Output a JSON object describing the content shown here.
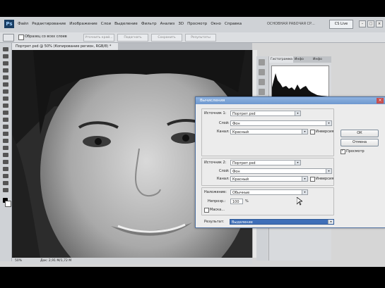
{
  "app": {
    "logo": "Ps",
    "menu": [
      "Файл",
      "Редактирование",
      "Изображение",
      "Слои",
      "Выделение",
      "Фильтр",
      "Анализ",
      "3D",
      "Просмотр",
      "Окно",
      "Справка"
    ],
    "workspace": "ОСНОВНАЯ РАБОЧАЯ СР...",
    "cs_live": "CS Live",
    "options": {
      "sample_all_layers": "Образец со всех слоев",
      "buttons": [
        "Уточнить край...",
        "Подогнать",
        "Сохранить",
        "Результаты"
      ]
    },
    "doc_tab": "Портрет.psd @ 50% (Копирование регион, RGB/8) *",
    "status": {
      "zoom": "50%",
      "doc": "Док: 2,91 М/1,72 М"
    }
  },
  "panel": {
    "tabs": [
      "Гистограмма",
      "Инфо",
      "Инфо"
    ]
  },
  "dialog": {
    "title": "Вычисления",
    "source1": {
      "label": "Источник 1:",
      "value": "Портрет.psd",
      "layer_label": "Слой:",
      "layer_value": "Фон",
      "channel_label": "Канал:",
      "channel_value": "Красный",
      "invert_label": "Инверсия"
    },
    "source2": {
      "label": "Источник 2:",
      "value": "Портрет.psd",
      "layer_label": "Слой:",
      "layer_value": "Фон",
      "channel_label": "Канал:",
      "channel_value": "Красный",
      "invert_label": "Инверсия"
    },
    "blending": {
      "label": "Наложение:",
      "value": "Обычные",
      "opacity_label": "Непрозр.:",
      "opacity_value": "100",
      "opacity_unit": "%",
      "mask_label": "Маска..."
    },
    "result": {
      "label": "Результат:",
      "value": "Выделение"
    },
    "ok_label": "ОК",
    "cancel_label": "Отмена",
    "preview_label": "Просмотр"
  }
}
